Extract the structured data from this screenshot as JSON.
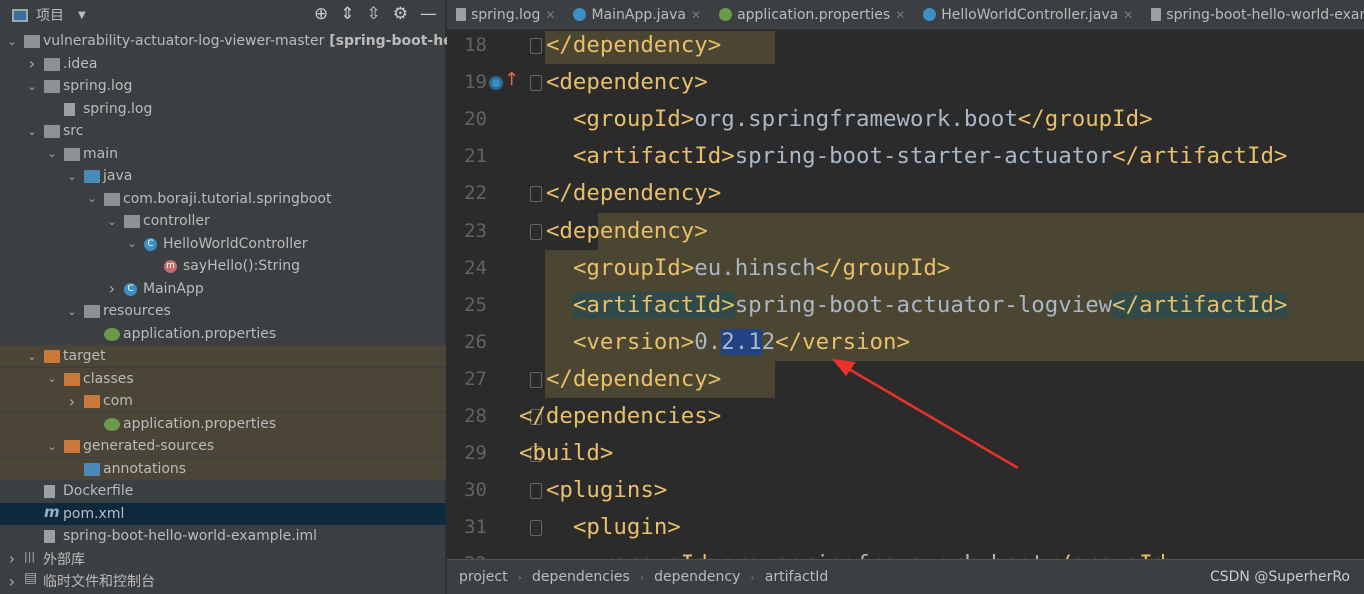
{
  "project_panel": {
    "title": "项目",
    "tree": [
      {
        "label": "vulnerability-actuator-log-viewer-master",
        "suffix": " [spring-boot-hello-",
        "level": 0,
        "arrow": "down",
        "icon": "module"
      },
      {
        "label": ".idea",
        "level": 1,
        "arrow": "right",
        "icon": "folder"
      },
      {
        "label": "spring.log",
        "level": 1,
        "arrow": "down",
        "icon": "folder"
      },
      {
        "label": "spring.log",
        "level": 2,
        "icon": "file"
      },
      {
        "label": "src",
        "level": 1,
        "arrow": "down",
        "icon": "folder"
      },
      {
        "label": "main",
        "level": 2,
        "arrow": "down",
        "icon": "folder"
      },
      {
        "label": "java",
        "level": 3,
        "arrow": "down",
        "icon": "folder-blue"
      },
      {
        "label": "com.boraji.tutorial.springboot",
        "level": 4,
        "arrow": "down",
        "icon": "package"
      },
      {
        "label": "controller",
        "level": 5,
        "arrow": "down",
        "icon": "package"
      },
      {
        "label": "HelloWorldController",
        "level": 6,
        "arrow": "down",
        "icon": "class"
      },
      {
        "label": "sayHello():String",
        "level": 7,
        "icon": "method"
      },
      {
        "label": "MainApp",
        "level": 5,
        "arrow": "right",
        "icon": "class"
      },
      {
        "label": "resources",
        "level": 3,
        "arrow": "down",
        "icon": "folder"
      },
      {
        "label": "application.properties",
        "level": 4,
        "icon": "properties"
      },
      {
        "label": "target",
        "level": 1,
        "arrow": "down",
        "icon": "folder-orange",
        "highlight": true
      },
      {
        "label": "classes",
        "level": 2,
        "arrow": "down",
        "icon": "folder-orange",
        "highlight": true
      },
      {
        "label": "com",
        "level": 3,
        "arrow": "right",
        "icon": "folder-orange",
        "highlight": true
      },
      {
        "label": "application.properties",
        "level": 4,
        "icon": "properties",
        "highlight": true
      },
      {
        "label": "generated-sources",
        "level": 2,
        "arrow": "down",
        "icon": "folder-orange",
        "highlight": true
      },
      {
        "label": "annotations",
        "level": 3,
        "icon": "folder-blue",
        "highlight": true
      },
      {
        "label": "Dockerfile",
        "level": 1,
        "icon": "file"
      },
      {
        "label": "pom.xml",
        "level": 1,
        "icon": "maven",
        "selected": true
      },
      {
        "label": "spring-boot-hello-world-example.iml",
        "level": 1,
        "icon": "file"
      },
      {
        "label": "外部库",
        "level": 0,
        "arrow": "right",
        "icon": "library"
      },
      {
        "label": "临时文件和控制台",
        "level": 0,
        "arrow": "right",
        "icon": "console"
      }
    ]
  },
  "tabs": [
    {
      "label": "spring.log"
    },
    {
      "label": "MainApp.java"
    },
    {
      "label": "application.properties"
    },
    {
      "label": "HelloWorldController.java"
    },
    {
      "label": "spring-boot-hello-world-exam"
    }
  ],
  "editor": {
    "lines": [
      {
        "n": "18",
        "indent": 2,
        "text": "</dependency>"
      },
      {
        "n": "19",
        "indent": 2,
        "text": "<dependency>"
      },
      {
        "n": "20",
        "indent": 3,
        "text": "<groupId>org.springframework.boot</groupId>"
      },
      {
        "n": "21",
        "indent": 3,
        "text": "<artifactId>spring-boot-starter-actuator</artifactId>"
      },
      {
        "n": "22",
        "indent": 2,
        "text": "</dependency>"
      },
      {
        "n": "23",
        "indent": 2,
        "text": "<dependency>"
      },
      {
        "n": "24",
        "indent": 3,
        "text": "<groupId>eu.hinsch</groupId>"
      },
      {
        "n": "25",
        "indent": 3,
        "text": "<artifactId>spring-boot-actuator-logview</artifactId>"
      },
      {
        "n": "26",
        "indent": 3,
        "text": "<version>0.2.12</version>"
      },
      {
        "n": "27",
        "indent": 2,
        "text": "</dependency>"
      },
      {
        "n": "28",
        "indent": 1,
        "text": "</dependencies>"
      },
      {
        "n": "29",
        "indent": 1,
        "text": "<build>"
      },
      {
        "n": "30",
        "indent": 2,
        "text": "<plugins>"
      },
      {
        "n": "31",
        "indent": 3,
        "text": "<plugin>"
      },
      {
        "n": "32",
        "indent": 4,
        "text": "<groupId>org.springframework.boot</groupId>"
      }
    ],
    "selected_text": "2.1"
  },
  "breadcrumb": [
    "project",
    "dependencies",
    "dependency",
    "artifactId"
  ],
  "watermark": "CSDN @SuperherRo",
  "colors": {
    "tag": "#e8bf6a",
    "text": "#a9b7c6",
    "arrow": "#e8322a",
    "selection": "#214283"
  }
}
